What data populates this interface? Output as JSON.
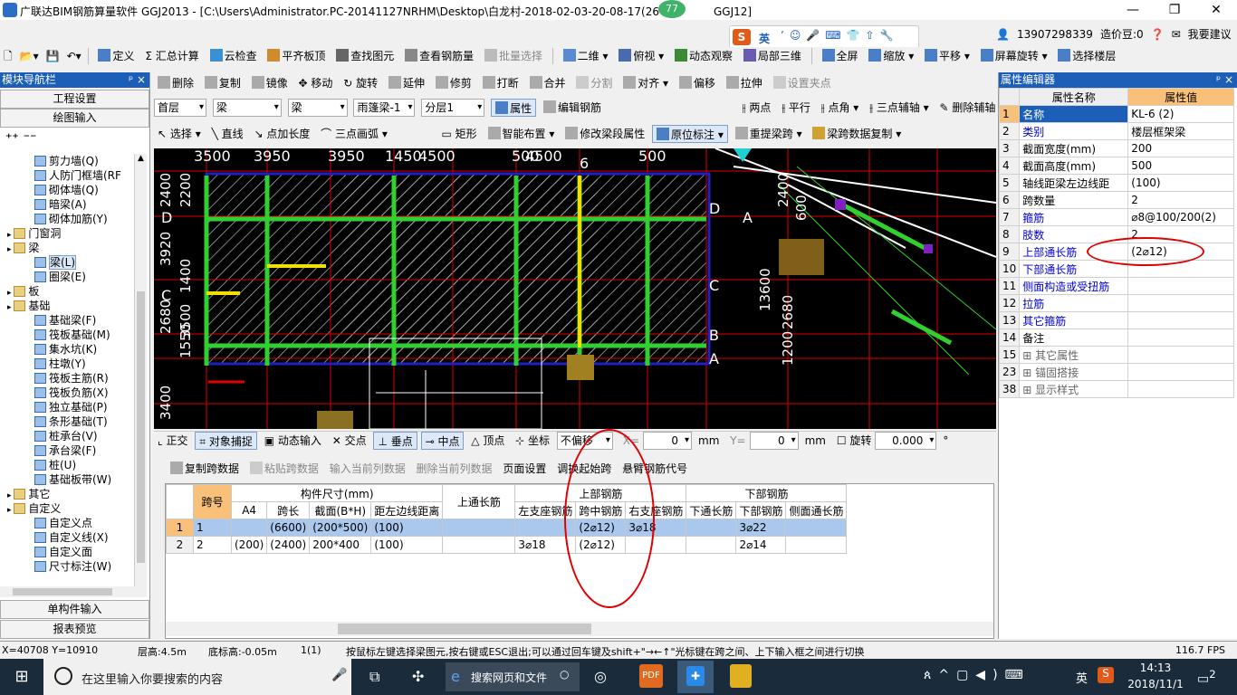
{
  "title": {
    "app": "广联达BIM钢筋算量软件 GGJ2013 - [C:\\Users\\Administrator.PC-20141127NRHM\\Desktop\\白龙村-2018-02-03-20-08-17(26",
    "suffix": "GGJ12]",
    "badge": "77"
  },
  "topright": {
    "ime": "英",
    "phone": "13907298339",
    "zaojia": "造价豆:0",
    "suggest": "我要建议"
  },
  "menu1": [
    "定义",
    "汇总计算",
    "云检查",
    "平齐板顶",
    "查找图元",
    "查看钢筋量",
    "批量选择",
    "二维",
    "俯视",
    "动态观察",
    "局部三维",
    "全屏",
    "缩放",
    "平移",
    "屏幕旋转",
    "选择楼层"
  ],
  "menu2": [
    "删除",
    "复制",
    "镜像",
    "移动",
    "旋转",
    "延伸",
    "修剪",
    "打断",
    "合并",
    "分割",
    "对齐",
    "偏移",
    "拉伸",
    "设置夹点"
  ],
  "combos": [
    "首层",
    "梁",
    "梁",
    "雨篷梁-1",
    "分层1"
  ],
  "menu3a": [
    "属性",
    "编辑钢筋"
  ],
  "menu3b": [
    "两点",
    "平行",
    "点角",
    "三点辅轴",
    "删除辅轴"
  ],
  "menu4": [
    "选择",
    "直线",
    "点加长度",
    "三点画弧",
    "矩形",
    "智能布置",
    "修改梁段属性",
    "原位标注",
    "重提梁跨",
    "梁跨数据复制"
  ],
  "nav": {
    "title": "模块导航栏",
    "btn1": "工程设置",
    "btn2": "绘图输入",
    "btn3": "单构件输入",
    "btn4": "报表预览",
    "tree": [
      {
        "label": "剪力墙(Q)",
        "level": 2,
        "kind": "item"
      },
      {
        "label": "人防门框墙(RF",
        "level": 2,
        "kind": "item"
      },
      {
        "label": "砌体墙(Q)",
        "level": 2,
        "kind": "item"
      },
      {
        "label": "暗梁(A)",
        "level": 2,
        "kind": "item"
      },
      {
        "label": "砌体加筋(Y)",
        "level": 2,
        "kind": "item"
      },
      {
        "label": "门窗洞",
        "level": 1,
        "kind": "folder"
      },
      {
        "label": "梁",
        "level": 1,
        "kind": "folder"
      },
      {
        "label": "梁(L)",
        "level": 2,
        "kind": "item"
      },
      {
        "label": "圈梁(E)",
        "level": 2,
        "kind": "item"
      },
      {
        "label": "板",
        "level": 1,
        "kind": "folder"
      },
      {
        "label": "基础",
        "level": 1,
        "kind": "folder"
      },
      {
        "label": "基础梁(F)",
        "level": 2,
        "kind": "item"
      },
      {
        "label": "筏板基础(M)",
        "level": 2,
        "kind": "item"
      },
      {
        "label": "集水坑(K)",
        "level": 2,
        "kind": "item"
      },
      {
        "label": "柱墩(Y)",
        "level": 2,
        "kind": "item"
      },
      {
        "label": "筏板主筋(R)",
        "level": 2,
        "kind": "item"
      },
      {
        "label": "筏板负筋(X)",
        "level": 2,
        "kind": "item"
      },
      {
        "label": "独立基础(P)",
        "level": 2,
        "kind": "item"
      },
      {
        "label": "条形基础(T)",
        "level": 2,
        "kind": "item"
      },
      {
        "label": "桩承台(V)",
        "level": 2,
        "kind": "item"
      },
      {
        "label": "承台梁(F)",
        "level": 2,
        "kind": "item"
      },
      {
        "label": "桩(U)",
        "level": 2,
        "kind": "item"
      },
      {
        "label": "基础板带(W)",
        "level": 2,
        "kind": "item"
      },
      {
        "label": "其它",
        "level": 1,
        "kind": "folder"
      },
      {
        "label": "自定义",
        "level": 1,
        "kind": "folder"
      },
      {
        "label": "自定义点",
        "level": 2,
        "kind": "item"
      },
      {
        "label": "自定义线(X)",
        "level": 2,
        "kind": "item"
      },
      {
        "label": "自定义面",
        "level": 2,
        "kind": "item"
      },
      {
        "label": "尺寸标注(W)",
        "level": 2,
        "kind": "item"
      }
    ]
  },
  "canvas_labels": {
    "top": [
      "3500",
      "3950",
      "3950",
      "1450",
      "4500",
      "500",
      "4500",
      "500"
    ],
    "axisA": "A",
    "axisB": "B",
    "axisC": "C",
    "axisD": "D",
    "left": [
      "2400",
      "2200",
      "3920",
      "1400",
      "2680",
      "3500",
      "1550",
      "3400",
      "2200"
    ],
    "right": [
      "2400",
      "600",
      "13600",
      "2680",
      "1200",
      "3500",
      "500"
    ],
    "col6": "6"
  },
  "snap": {
    "items": [
      "正交",
      "对象捕捉",
      "动态输入",
      "交点",
      "垂点",
      "中点",
      "顶点",
      "坐标"
    ],
    "offset_mode": "不偏移",
    "x_label": "X=",
    "x_val": "0",
    "unit1": "mm",
    "y_label": "Y=",
    "y_val": "0",
    "unit2": "mm",
    "rotate": "旋转",
    "rot_val": "0.000",
    "deg": "°"
  },
  "spanbar": [
    "复制跨数据",
    "粘贴跨数据",
    "输入当前列数据",
    "删除当前列数据",
    "页面设置",
    "调换起始跨",
    "悬臂钢筋代号"
  ],
  "grid": {
    "h1": {
      "kuahao": "跨号",
      "gjcc": "构件尺寸(mm)",
      "stcj": "上通长筋",
      "sbgj": "上部钢筋",
      "xbgj": "下部钢筋"
    },
    "h2": [
      "A4",
      "跨长",
      "截面(B*H)",
      "距左边线距离",
      "左支座钢筋",
      "跨中钢筋",
      "右支座钢筋",
      "下通长筋",
      "下部钢筋",
      "侧面通长筋"
    ],
    "rows": [
      {
        "n": "1",
        "kh": "1",
        "a4": "",
        "kc": "(6600)",
        "jm": "(200*500)",
        "jl": "(100)",
        "st": "",
        "zz": "",
        "kz": "(2⌀12)",
        "yz": "3⌀18",
        "xt": "",
        "xb": "3⌀22",
        "cm": ""
      },
      {
        "n": "2",
        "kh": "2",
        "a4": "(200)",
        "kc": "(2400)",
        "jm": "200*400",
        "jl": "(100)",
        "st": "",
        "zz": "3⌀18",
        "kz": "(2⌀12)",
        "yz": "",
        "xt": "",
        "xb": "2⌀14",
        "cm": ""
      }
    ]
  },
  "props": {
    "title": "属性编辑器",
    "col_name": "属性名称",
    "col_val": "属性值",
    "rows": [
      {
        "n": "1",
        "name": "名称",
        "val": "KL-6 (2)",
        "blue": true
      },
      {
        "n": "2",
        "name": "类别",
        "val": "楼层框架梁",
        "blue": true
      },
      {
        "n": "3",
        "name": "截面宽度(mm)",
        "val": "200",
        "blue": false
      },
      {
        "n": "4",
        "name": "截面高度(mm)",
        "val": "500",
        "blue": false
      },
      {
        "n": "5",
        "name": "轴线距梁左边线距",
        "val": "(100)",
        "blue": false
      },
      {
        "n": "6",
        "name": "跨数量",
        "val": "2",
        "blue": false
      },
      {
        "n": "7",
        "name": "箍筋",
        "val": "⌀8@100/200(2)",
        "blue": true
      },
      {
        "n": "8",
        "name": "肢数",
        "val": "2",
        "blue": true
      },
      {
        "n": "9",
        "name": "上部通长筋",
        "val": "(2⌀12)",
        "blue": true
      },
      {
        "n": "10",
        "name": "下部通长筋",
        "val": "",
        "blue": true
      },
      {
        "n": "11",
        "name": "侧面构造或受扭筋",
        "val": "",
        "blue": true
      },
      {
        "n": "12",
        "name": "拉筋",
        "val": "",
        "blue": true
      },
      {
        "n": "13",
        "name": "其它箍筋",
        "val": "",
        "blue": true
      },
      {
        "n": "14",
        "name": "备注",
        "val": "",
        "blue": false
      },
      {
        "n": "15",
        "name": "其它属性",
        "val": "",
        "blue": false,
        "plus": true
      },
      {
        "n": "23",
        "name": "锚固搭接",
        "val": "",
        "blue": false,
        "plus": true
      },
      {
        "n": "38",
        "name": "显示样式",
        "val": "",
        "blue": false,
        "plus": true
      }
    ]
  },
  "status": {
    "coords": "X=40708 Y=10910",
    "floorh": "层高:4.5m",
    "bottomh": "底标高:-0.05m",
    "count": "1(1)",
    "hint": "按鼠标左键选择梁图元,按右键或ESC退出;可以通过回车键及shift+\"→←↑\"光标键在跨之间、上下输入框之间进行切换",
    "fps": "116.7 FPS"
  },
  "taskbar": {
    "search": "在这里输入你要搜索的内容",
    "websearch": "搜索网页和文件",
    "time": "14:13",
    "date": "2018/11/1",
    "lang": "英",
    "notify": "2"
  },
  "colors": {
    "accent": "#1c5fb8",
    "sel_row": "#aac8ee",
    "red": "#e00000",
    "canvas_bg": "#000000",
    "header_orange": "#f8c078"
  }
}
